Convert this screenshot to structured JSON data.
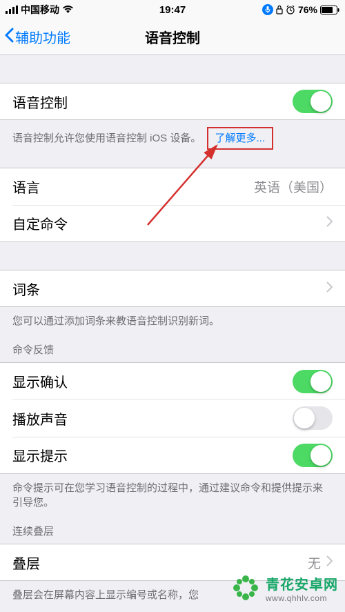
{
  "statusbar": {
    "carrier": "中国移动",
    "time": "19:47",
    "battery": "76%"
  },
  "nav": {
    "back_label": "辅助功能",
    "title": "语音控制"
  },
  "voice_control": {
    "label": "语音控制",
    "on": true,
    "footer_prefix": "语音控制允许您使用语音控制 iOS 设备。",
    "learn_more": "了解更多..."
  },
  "language_row": {
    "label": "语言",
    "value": "英语（美国）"
  },
  "custom_commands_row": {
    "label": "自定命令"
  },
  "vocabulary_row": {
    "label": "词条",
    "footer": "您可以通过添加词条来教语音控制识别新词。"
  },
  "feedback_header": "命令反馈",
  "show_confirm": {
    "label": "显示确认",
    "on": true
  },
  "play_sound": {
    "label": "播放声音",
    "on": false
  },
  "show_hints": {
    "label": "显示提示",
    "on": true
  },
  "hints_footer": "命令提示可在您学习语音控制的过程中，通过建议命令和提供提示来引导您。",
  "overlay_header": "连续叠层",
  "overlay_row": {
    "label": "叠层",
    "value": "无"
  },
  "overlay_footer_partial": "叠层会在屏幕内容上显示编号或名称，您",
  "watermark": {
    "name": "青花安卓网",
    "url": "www.qhhlv.com"
  }
}
